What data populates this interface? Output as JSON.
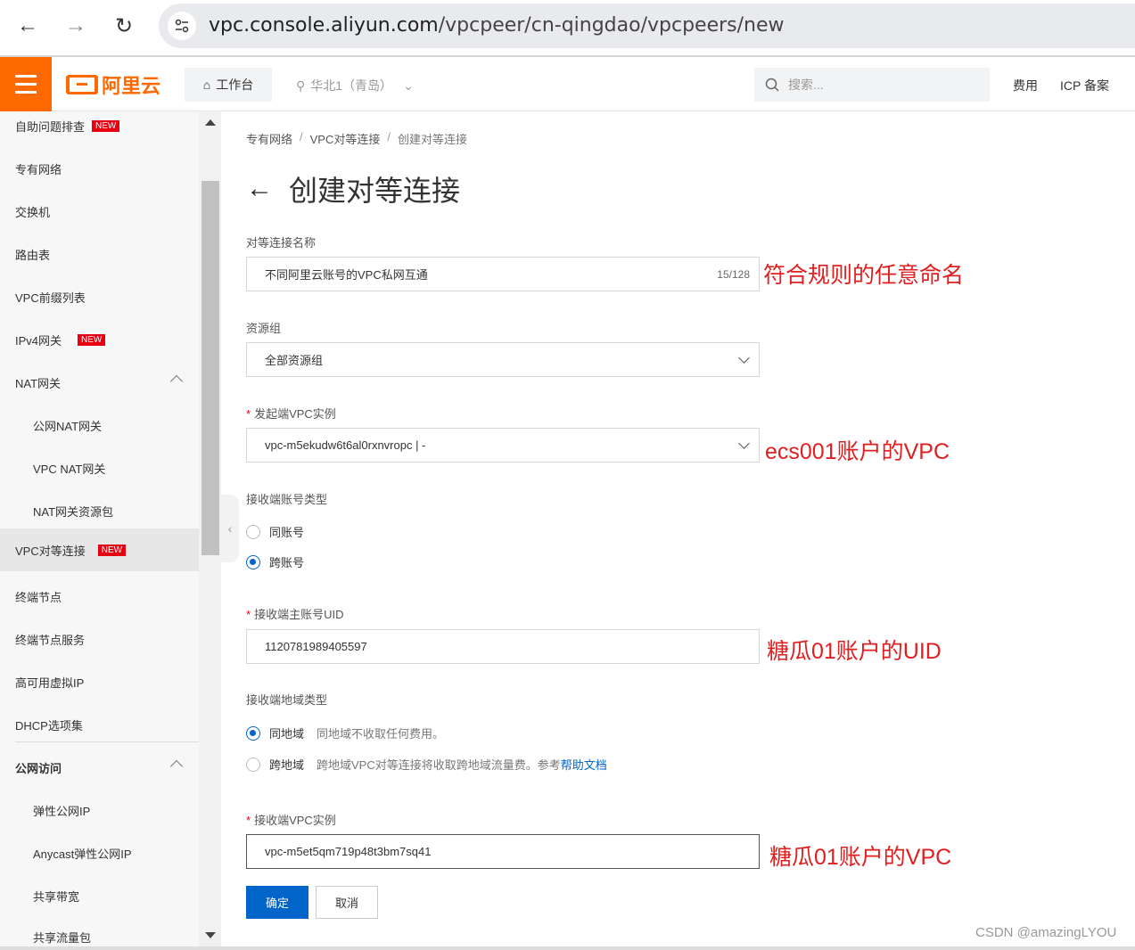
{
  "browser": {
    "url_host": "vpc.console.aliyun.com",
    "url_path": "/vpcpeer/cn-qingdao/vpcpeers/new"
  },
  "topbar": {
    "logo_text": "阿里云",
    "workbench": "工作台",
    "region": "华北1（青岛）",
    "search_placeholder": "搜索...",
    "links": [
      "费用",
      "ICP 备案"
    ]
  },
  "sidebar": {
    "items": [
      {
        "label": "自助问题排查",
        "badge": "NEW"
      },
      {
        "label": "专有网络"
      },
      {
        "label": "交换机"
      },
      {
        "label": "路由表"
      },
      {
        "label": "VPC前缀列表"
      },
      {
        "label": "IPv4网关",
        "badge": "NEW"
      },
      {
        "label": "NAT网关"
      },
      {
        "label": "公网NAT网关"
      },
      {
        "label": "VPC NAT网关"
      },
      {
        "label": "NAT网关资源包"
      },
      {
        "label": "VPC对等连接",
        "badge": "NEW"
      },
      {
        "label": "终端节点"
      },
      {
        "label": "终端节点服务"
      },
      {
        "label": "高可用虚拟IP"
      },
      {
        "label": "DHCP选项集"
      },
      {
        "label": "公网访问"
      },
      {
        "label": "弹性公网IP"
      },
      {
        "label": "Anycast弹性公网IP"
      },
      {
        "label": "共享带宽"
      },
      {
        "label": "共享流量包"
      }
    ]
  },
  "breadcrumb": [
    "专有网络",
    "VPC对等连接",
    "创建对等连接"
  ],
  "breadcrumb_sep": "/",
  "page_title": "创建对等连接",
  "form": {
    "name_label": "对等连接名称",
    "name_value": "不同阿里云账号的VPC私网互通",
    "name_counter": "15/128",
    "resource_group_label": "资源组",
    "resource_group_value": "全部资源组",
    "initiator_vpc_label": "发起端VPC实例",
    "initiator_vpc_value": "vpc-m5ekudw6t6al0rxnvropc | -",
    "account_type_label": "接收端账号类型",
    "account_same": "同账号",
    "account_cross": "跨账号",
    "uid_label": "接收端主账号UID",
    "uid_value": "1120781989405597",
    "region_type_label": "接收端地域类型",
    "region_same": "同地域",
    "region_same_hint": "同地域不收取任何费用。",
    "region_cross": "跨地域",
    "region_cross_hint": "跨地域VPC对等连接将收取跨地域流量费。参考",
    "region_cross_link": "帮助文档",
    "accepter_vpc_label": "接收端VPC实例",
    "accepter_vpc_value": "vpc-m5et5qm719p48t3bm7sq41",
    "required_mark": "*",
    "ok": "确定",
    "cancel": "取消"
  },
  "annotations": {
    "name": "符合规则的任意命名",
    "initiator": "ecs001账户的VPC",
    "uid": "糖瓜01账户的UID",
    "accepter": "糖瓜01账户的VPC"
  },
  "watermark": "CSDN @amazingLYOU",
  "colors": {
    "brand": "#ff6a00",
    "primary": "#0064c8",
    "annotation": "#e02020",
    "badge": "#e60012"
  }
}
